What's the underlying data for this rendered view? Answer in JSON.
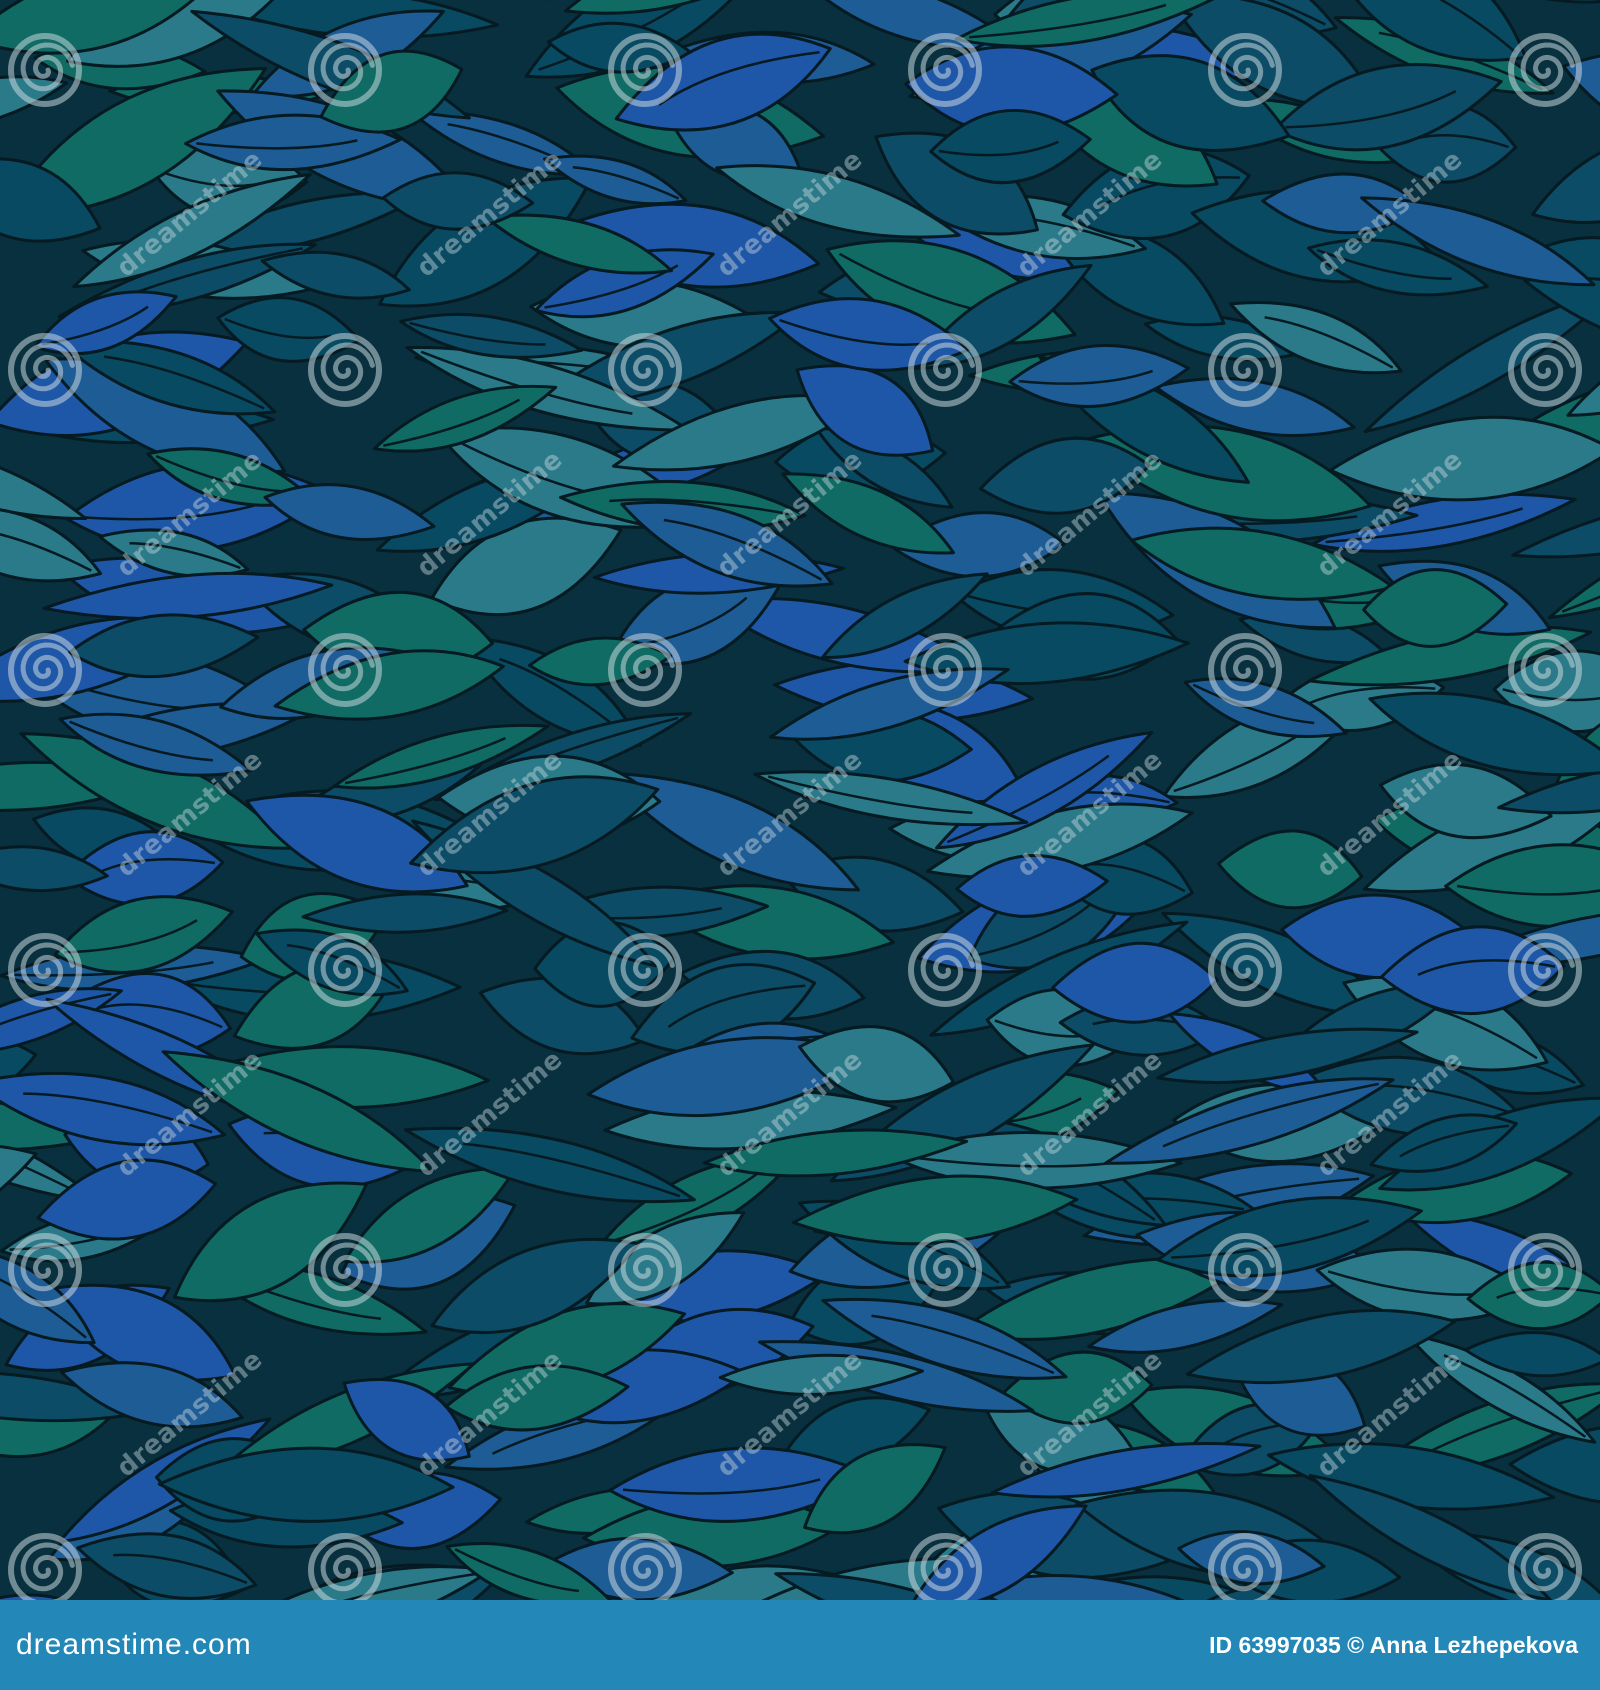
{
  "image": {
    "subject": "seamless hand-drawn leaf pattern in blue, teal and green on a dark navy background",
    "background_color": "#08303f",
    "outline_color": "#061a22",
    "leaf_palette": [
      "#084a62",
      "#0c4c66",
      "#0f6b63",
      "#2a7a8a",
      "#1f57a8",
      "#1e5c96"
    ]
  },
  "watermark": {
    "brand": "dreamstime",
    "icon": "spiral-icon"
  },
  "footer": {
    "logo_text": "dreamstime.com",
    "credit_text": "ID 63997035 © Anna Lezhepekova",
    "background_color": "#2387b8"
  }
}
